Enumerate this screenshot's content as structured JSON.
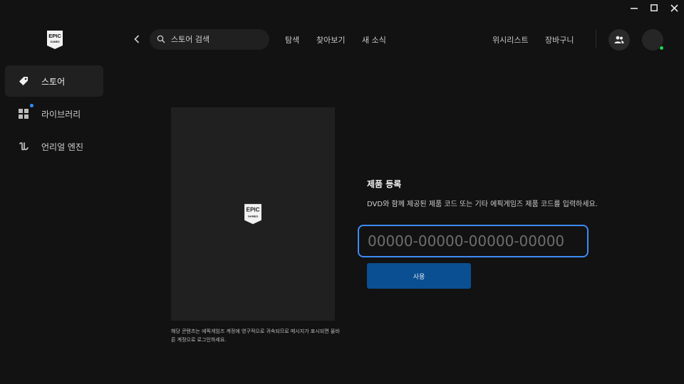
{
  "window": {
    "controls": [
      "minimize",
      "maximize",
      "close"
    ]
  },
  "brand": {
    "logo_line1": "EPIC",
    "logo_line2": "GAMES"
  },
  "sidebar": {
    "items": [
      {
        "label": "스토어",
        "icon": "tag-icon",
        "active": true
      },
      {
        "label": "라이브러리",
        "icon": "grid-icon",
        "active": false,
        "notification": true
      },
      {
        "label": "언리얼 엔진",
        "icon": "unreal-icon",
        "active": false
      }
    ]
  },
  "header": {
    "search_placeholder": "스토어 검색",
    "links": [
      "탐색",
      "찾아보기",
      "새 소식"
    ],
    "wishlist": "위시리스트",
    "cart": "장바구니"
  },
  "product": {
    "notice": "해당 콘텐츠는 에픽게임즈 계정에 영구적으로 귀속되므로 메시지가 표시되면 올바른 계정으로 로그인하세요."
  },
  "registration": {
    "title": "제품 등록",
    "description": "DVD와 함께 제공된 제품 코드 또는 기타 에픽게임즈 제품 코드를 입력하세요.",
    "code_placeholder": "00000-00000-00000-00000",
    "code_value": "",
    "submit_label": "사용"
  },
  "colors": {
    "background": "#121212",
    "panel": "#202020",
    "accent_border": "#3d8bf5",
    "button": "#0a4f91",
    "notification_dot": "#2e8fff",
    "online_dot": "#1fd15c"
  }
}
